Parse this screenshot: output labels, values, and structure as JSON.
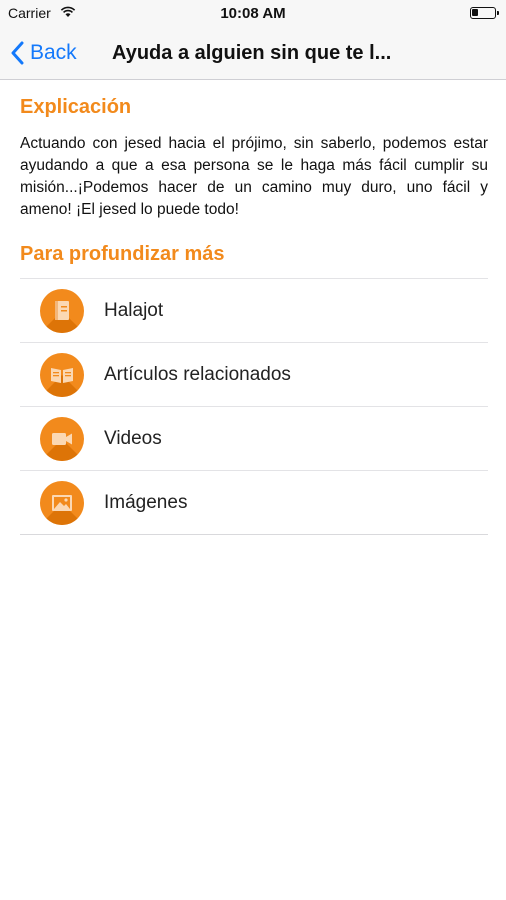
{
  "status_bar": {
    "carrier": "Carrier",
    "time": "10:08 AM"
  },
  "nav": {
    "back_label": "Back",
    "title": "Ayuda a alguien sin que te l..."
  },
  "explicacion": {
    "title": "Explicación",
    "text": "Actuando con jesed hacia el prójimo, sin saberlo, podemos estar ayudando a que a esa persona se le haga más fácil cumplir su misión...¡Podemos hacer de un camino muy duro, uno fácil y ameno! ¡El jesed lo puede todo!"
  },
  "profundizar": {
    "title": "Para profundizar más",
    "items": [
      {
        "label": "Halajot",
        "icon": "halajot-book-icon"
      },
      {
        "label": "Artículos relacionados",
        "icon": "open-book-icon"
      },
      {
        "label": "Videos",
        "icon": "video-camera-icon"
      },
      {
        "label": "Imágenes",
        "icon": "image-icon"
      }
    ]
  },
  "colors": {
    "accent": "#f28a1c",
    "link": "#1479fb"
  }
}
